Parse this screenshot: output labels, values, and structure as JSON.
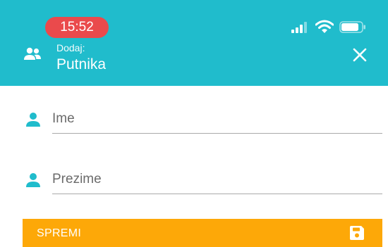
{
  "status_bar": {
    "time": "15:52",
    "time_pill_color": "#ea4a4c"
  },
  "header": {
    "background": "#20bccc",
    "icon": "people-icon",
    "subtitle": "Dodaj:",
    "title": "Putnika",
    "close_icon": "close-icon"
  },
  "form": {
    "fields": [
      {
        "icon": "person-icon",
        "placeholder": "Ime",
        "value": ""
      },
      {
        "icon": "person-icon",
        "placeholder": "Prezime",
        "value": ""
      }
    ]
  },
  "save_button": {
    "label": "SPREMI",
    "icon": "save-icon",
    "color": "#fda808"
  }
}
